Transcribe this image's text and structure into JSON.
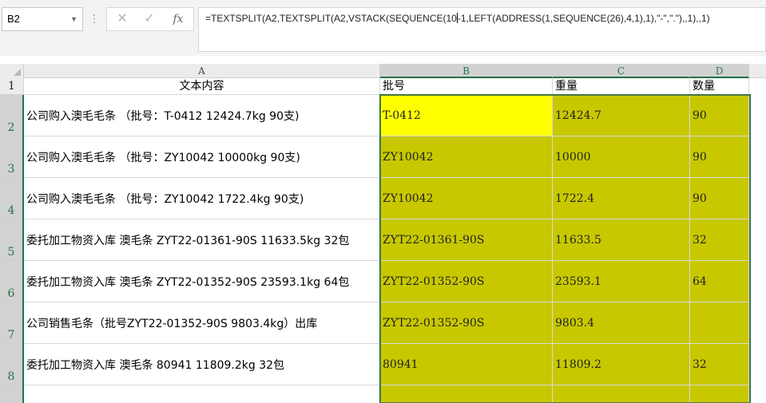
{
  "name_box": {
    "value": "B2"
  },
  "formula_bar": {
    "cancel_glyph": "✕",
    "enter_glyph": "✓",
    "fx_label": "fx",
    "formula_before_cursor": "=TEXTSPLIT(A2,TEXTSPLIT(A2,VSTACK(SEQUENCE(10",
    "formula_after_cursor": "-1,LEFT(ADDRESS(1,SEQUENCE(26),4,1),1),\"-\",\".\"),,1),,1)"
  },
  "columns": [
    {
      "letter": "A"
    },
    {
      "letter": "B"
    },
    {
      "letter": "C"
    },
    {
      "letter": "D"
    }
  ],
  "header_row": {
    "row_number": "1",
    "a": "文本内容",
    "b": "批号",
    "c": "重量",
    "d": "数量"
  },
  "rows": [
    {
      "num": "2",
      "a": "公司购入澳毛毛条 （批号：T-0412 12424.7kg 90支)",
      "b": "T-0412",
      "c": "12424.7",
      "d": "90"
    },
    {
      "num": "3",
      "a": "公司购入澳毛毛条 （批号：ZY10042 10000kg 90支)",
      "b": "ZY10042",
      "c": "10000",
      "d": "90"
    },
    {
      "num": "4",
      "a": "公司购入澳毛毛条 （批号：ZY10042 1722.4kg 90支)",
      "b": "ZY10042",
      "c": "1722.4",
      "d": "90"
    },
    {
      "num": "5",
      "a": "委托加工物资入库 澳毛条  ZYT22-01361-90S 11633.5kg 32包",
      "b": "ZYT22-01361-90S",
      "c": "11633.5",
      "d": "32"
    },
    {
      "num": "6",
      "a": "委托加工物资入库 澳毛条  ZYT22-01352-90S 23593.1kg 64包",
      "b": "ZYT22-01352-90S",
      "c": "23593.1",
      "d": "64"
    },
    {
      "num": "7",
      "a": "公司销售毛条（批号ZYT22-01352-90S 9803.4kg）出库",
      "b": "ZYT22-01352-90S",
      "c": "9803.4",
      "d": ""
    },
    {
      "num": "8",
      "a": "委托加工物资入库 澳毛条 80941 11809.2kg 32包",
      "b": "80941",
      "c": "11809.2",
      "d": "32"
    }
  ],
  "colors": {
    "spill_fill": "#c8c800",
    "active_fill": "#ffff00",
    "selection_border": "#217346"
  }
}
